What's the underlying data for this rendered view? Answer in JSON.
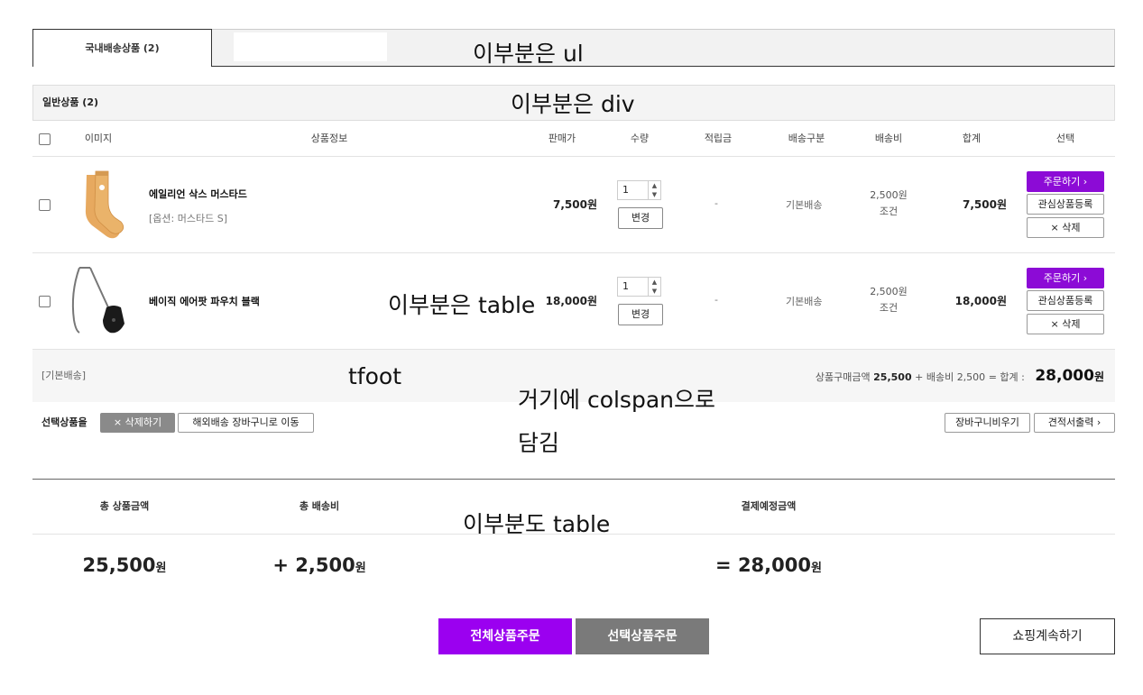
{
  "tabs": {
    "active_label": "국내배송상품 (2)"
  },
  "annotations": {
    "ul": "이부분은 ul",
    "div": "이부분은 div",
    "table": "이부분은 table",
    "tfoot": "tfoot",
    "colspan_line1": "거기에 colspan으로",
    "colspan_line2": "담김",
    "table2": "이부분도 table"
  },
  "section": {
    "title": "일반상품 (2)"
  },
  "columns": {
    "image": "이미지",
    "info": "상품정보",
    "price": "판매가",
    "qty": "수량",
    "points": "적립금",
    "ship_type": "배송구분",
    "ship_fee": "배송비",
    "total": "합계",
    "select": "선택"
  },
  "items": [
    {
      "name": "에일리언 삭스 머스타드",
      "option": "[옵션: 머스타드 S]",
      "price": "7,500원",
      "qty": "1",
      "points": "-",
      "ship_type": "기본배송",
      "ship_fee": "2,500원",
      "ship_cond": "조건",
      "total": "7,500원"
    },
    {
      "name": "베이직 에어팟 파우치 블랙",
      "option": "",
      "price": "18,000원",
      "qty": "1",
      "points": "-",
      "ship_type": "기본배송",
      "ship_fee": "2,500원",
      "ship_cond": "조건",
      "total": "18,000원"
    }
  ],
  "row_buttons": {
    "order": "주문하기",
    "wish": "관심상품등록",
    "delete": "삭제",
    "change": "변경"
  },
  "tfoot": {
    "label": "[기본배송]",
    "summary_prefix": "상품구매금액",
    "product_total": "25,500",
    "ship_prefix": "+ 배송비",
    "ship_fee": "2,500",
    "equals": "= 합계 :",
    "grand_total": "28,000",
    "grand_unit": "원"
  },
  "selected": {
    "label": "선택상품을",
    "delete": "삭제하기",
    "move": "해외배송 장바구니로 이동",
    "clear": "장바구니비우기",
    "estimate": "견적서출력"
  },
  "summary": {
    "product_head": "총 상품금액",
    "ship_head": "총 배송비",
    "pay_head": "결제예정금액",
    "product_value": "25,500",
    "ship_value": "+ 2,500",
    "pay_value": "= 28,000",
    "unit": "원"
  },
  "bottom": {
    "order_all": "전체상품주문",
    "order_selected": "선택상품주문",
    "continue": "쇼핑계속하기"
  },
  "colors": {
    "accent": "#9b00f0",
    "order_button": "#8c0bd6",
    "grey_button": "#7a7a7a"
  }
}
